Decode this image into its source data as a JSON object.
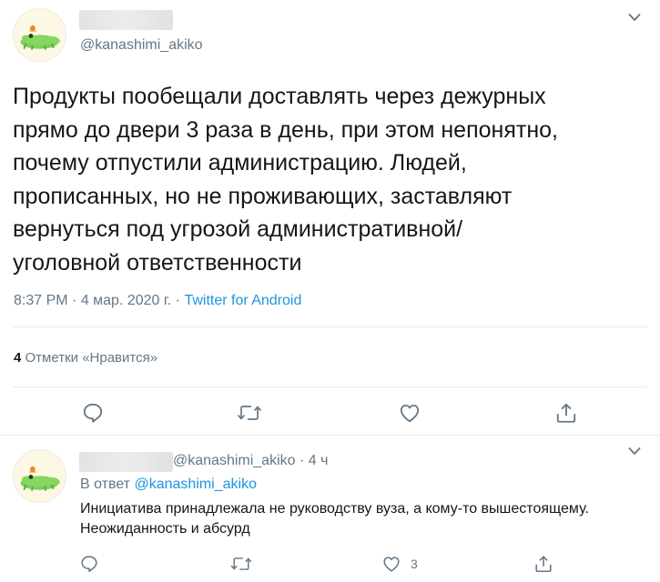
{
  "main_tweet": {
    "handle": "@kanashimi_akiko",
    "text": "Продукты пообещали доставлять через дежурных\nпрямо до двери 3 раза в день, при этом непонятно,\nпочему отпустили администрацию. Людей,\nпрописанных, но не проживающих, заставляют\nвернуться под угрозой административной/\nуголовной ответственности",
    "time": "8:37 PM",
    "separator": " · ",
    "date": "4 мар. 2020 г.",
    "source": "Twitter for Android",
    "likes_count": "4",
    "likes_label": "Отметки «Нравится»",
    "avatar_icon": "green-crocodile-avatar-icon"
  },
  "reply_tweet": {
    "handle": "@kanashimi_akiko",
    "separator": " · ",
    "time_ago": "4 ч",
    "reply_prefix": "В ответ ",
    "reply_to": "@kanashimi_akiko",
    "text": "Инициатива принадлежала не руководству вуза, а кому-то вышестоящему. Неожиданность и абсурд",
    "like_count": "3",
    "avatar_icon": "green-crocodile-avatar-icon"
  },
  "colors": {
    "text": "#14171a",
    "secondary": "#657786",
    "link": "#1b95e0",
    "divider": "#e6ecf0"
  }
}
